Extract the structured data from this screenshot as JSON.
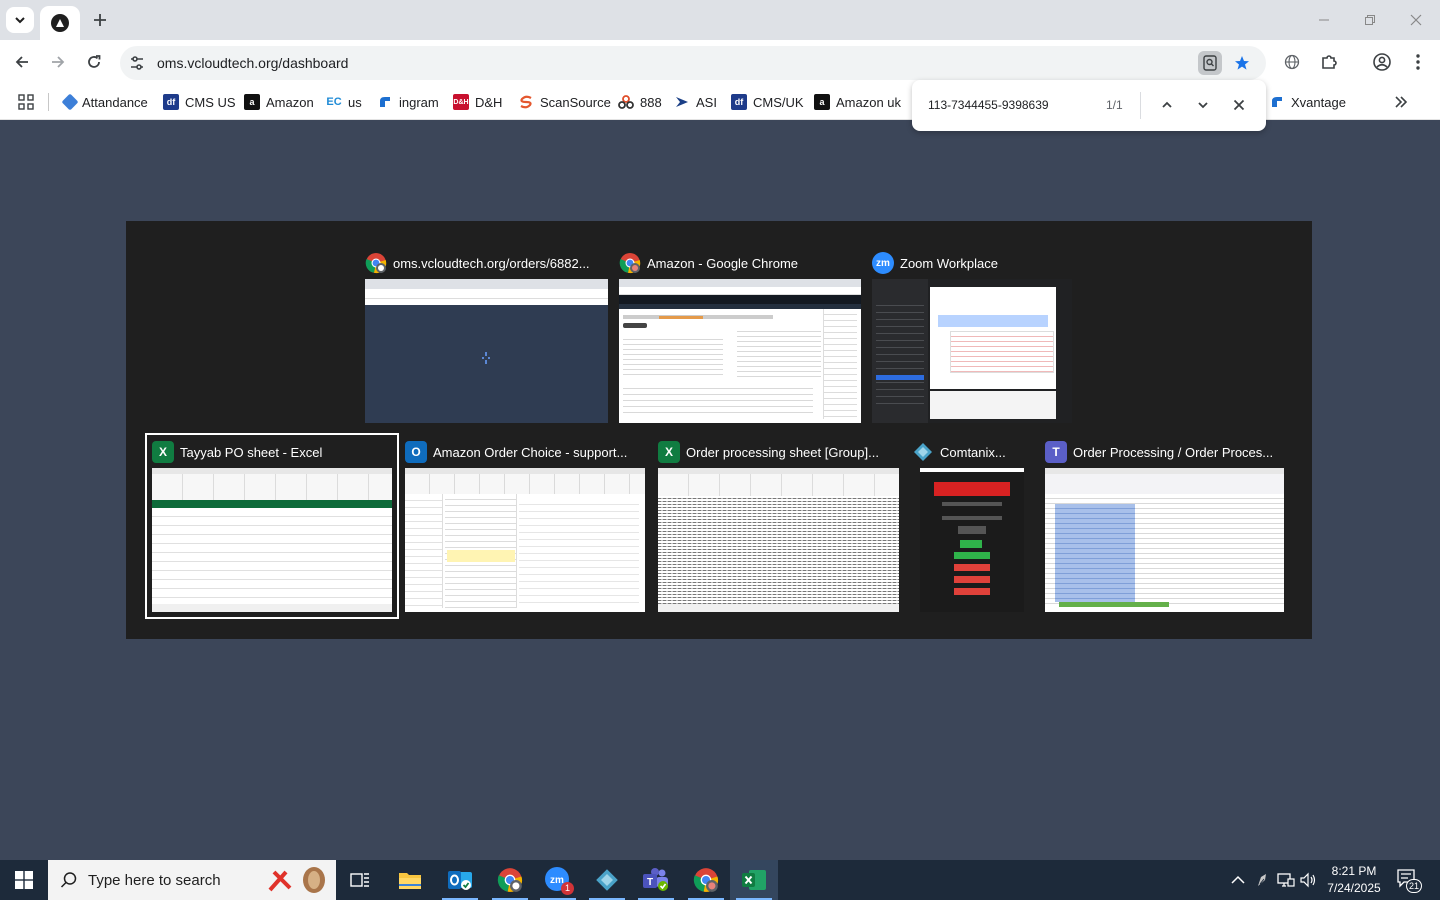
{
  "browser": {
    "url": "oms.vcloudtech.org/dashboard",
    "new_tab_label": "+"
  },
  "bookmarks": [
    {
      "label": "Attandance",
      "icon": "diamond-icon",
      "color": "#3d7fd8"
    },
    {
      "label": "CMS US",
      "icon": "df-icon",
      "color": "#1e3b8a"
    },
    {
      "label": "Amazon",
      "icon": "amazon-icon",
      "color": "#111111"
    },
    {
      "label": "us",
      "icon": "ec-icon",
      "color": "#1f8bd6"
    },
    {
      "label": "ingram",
      "icon": "ingram-icon",
      "color": "#1d6fd0"
    },
    {
      "label": "D&H",
      "icon": "dh-icon",
      "color": "#c8102e"
    },
    {
      "label": "ScanSource",
      "icon": "scansource-icon",
      "color": "#e4572e"
    },
    {
      "label": "888",
      "icon": "888-icon",
      "color": "#e04e2a"
    },
    {
      "label": "ASI",
      "icon": "asi-icon",
      "color": "#1a3f86"
    },
    {
      "label": "CMS/UK",
      "icon": "df-icon",
      "color": "#1e3b8a"
    },
    {
      "label": "Amazon uk",
      "icon": "amazon-icon",
      "color": "#111111"
    },
    {
      "label": "Xvantage",
      "icon": "xvantage-icon",
      "color": "#1d6fd0"
    }
  ],
  "find": {
    "query": "113-7344455-9398639",
    "count": "1/1"
  },
  "switcher": {
    "windows": [
      {
        "title": "oms.vcloudtech.org/orders/6882...",
        "app": "chrome-icon"
      },
      {
        "title": "Amazon - Google Chrome",
        "app": "chrome-icon"
      },
      {
        "title": "Zoom Workplace",
        "app": "zoom-icon",
        "app_text": "zm"
      },
      {
        "title": "Tayyab PO sheet - Excel",
        "app": "excel-icon",
        "app_text": "X",
        "selected": true
      },
      {
        "title": "Amazon Order Choice - support...",
        "app": "outlook-icon",
        "app_text": "O"
      },
      {
        "title": "Order processing sheet  [Group]...",
        "app": "excel-icon",
        "app_text": "X"
      },
      {
        "title": "Comtanix...",
        "app": "comtanix-icon"
      },
      {
        "title": "Order Processing / Order Proces...",
        "app": "teams-icon",
        "app_text": "T"
      }
    ]
  },
  "taskbar": {
    "search_placeholder": "Type here to search",
    "zoom_badge": "1",
    "time": "8:21 PM",
    "date": "7/24/2025",
    "notification_count": "21"
  },
  "colors": {
    "desktop": "#3c4659",
    "switcher_bg": "#1f1f1f",
    "taskbar": "#1d2a3a",
    "accent_blue": "#1a73e8",
    "excel_green": "#107c41",
    "outlook_blue": "#0f6cbd",
    "zoom_blue": "#2d8cff",
    "teams_purple": "#5b5fc7"
  }
}
